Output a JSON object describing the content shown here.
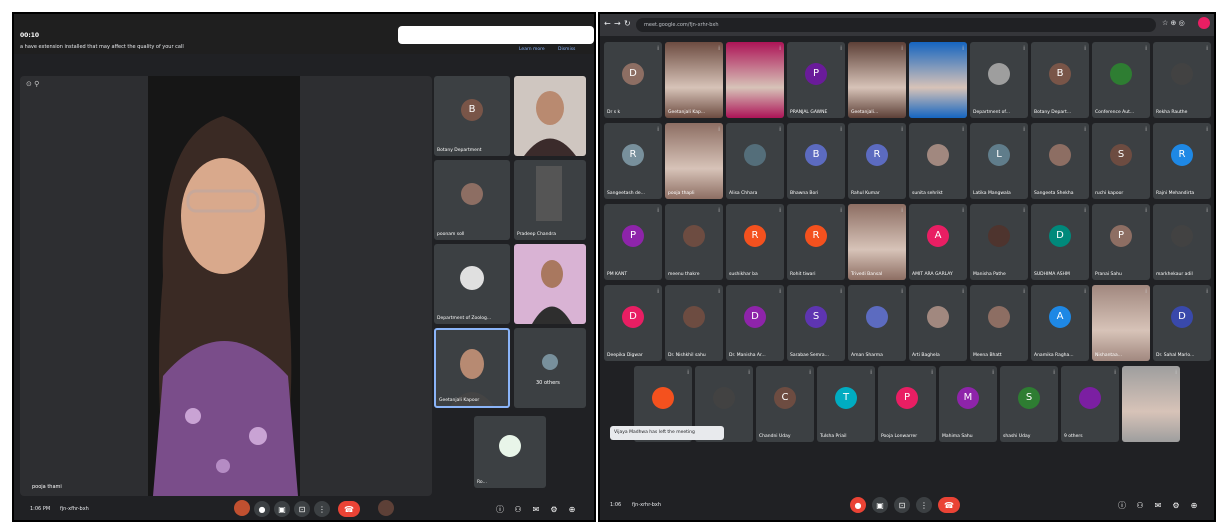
{
  "left": {
    "time_badge": "00:10",
    "warning": "a have extension installed that may affect the quality of your call",
    "warning_links": [
      "Learn more",
      "Dismiss"
    ],
    "main_speaker_name": "pooja thami",
    "sidebar_tiles": [
      {
        "label": "Botany Department",
        "avatar": "B",
        "color": "#795548"
      },
      {
        "label": "",
        "avatar": "",
        "color": "#5f6368"
      },
      {
        "label": "poonam soll",
        "avatar": "",
        "color": "#5f6368"
      },
      {
        "label": "Pradeep Chandra",
        "avatar": "",
        "color": "#5f6368"
      },
      {
        "label": "Department of Zoolog...",
        "avatar": "",
        "color": "#5f6368"
      },
      {
        "label": "",
        "avatar": "",
        "color": "#5f6368"
      },
      {
        "label": "Geetanjali Kapoor",
        "avatar": "",
        "color": "#5f6368"
      },
      {
        "label": "30 others",
        "avatar": "",
        "color": "#5f6368"
      },
      {
        "label": "Ro...",
        "avatar": "",
        "color": "#5f6368"
      }
    ],
    "bottom_time": "1:06 PM",
    "meeting_code": "fjn-xfhr-bxh"
  },
  "right": {
    "url": "meet.google.com/fjn-xrhr-bxh",
    "rows": [
      [
        {
          "label": "Dr s k",
          "avatar": "D",
          "color": "#8d6e63"
        },
        {
          "label": "Geetanjali Kap...",
          "avatar": "",
          "color": "#6d4c41",
          "photo": true
        },
        {
          "label": "",
          "avatar": "",
          "color": "#ad1457",
          "photo": true
        },
        {
          "label": "PRANJAL GAWNE",
          "avatar": "P",
          "color": "#6a1b9a"
        },
        {
          "label": "Geetanjali...",
          "avatar": "",
          "color": "#5d4037",
          "photo": true
        },
        {
          "label": "",
          "avatar": "",
          "color": "#1565c0",
          "photo": true
        },
        {
          "label": "Department of...",
          "avatar": "",
          "color": "#9e9e9e"
        },
        {
          "label": "Botany Depart...",
          "avatar": "B",
          "color": "#795548"
        },
        {
          "label": "Conference Aut...",
          "avatar": "",
          "color": "#2e7d32"
        },
        {
          "label": "Rekha Rauthe",
          "avatar": "",
          "color": "#424242"
        }
      ],
      [
        {
          "label": "Sangeetash de...",
          "avatar": "R",
          "color": "#78909c"
        },
        {
          "label": "pooja thapli",
          "avatar": "",
          "color": "#8d6e63",
          "photo": true
        },
        {
          "label": "Alisa Chhara",
          "avatar": "",
          "color": "#546e7a"
        },
        {
          "label": "Bhawna Bori",
          "avatar": "B",
          "color": "#5c6bc0"
        },
        {
          "label": "Rahul Kumar",
          "avatar": "R",
          "color": "#5c6bc0"
        },
        {
          "label": "sunita sehrikt",
          "avatar": "",
          "color": "#a1887f"
        },
        {
          "label": "Latika Mangwala",
          "avatar": "L",
          "color": "#607d8b"
        },
        {
          "label": "Sangeeta Shekha",
          "avatar": "",
          "color": "#8d6e63"
        },
        {
          "label": "ruchi kapoor",
          "avatar": "S",
          "color": "#6d4c41"
        },
        {
          "label": "Rajni Mehandirta",
          "avatar": "R",
          "color": "#1e88e5"
        }
      ],
      [
        {
          "label": "PM KANT",
          "avatar": "P",
          "color": "#8e24aa"
        },
        {
          "label": "meenu thakre",
          "avatar": "",
          "color": "#6d4c41"
        },
        {
          "label": "sushikhar ba",
          "avatar": "R",
          "color": "#f4511e"
        },
        {
          "label": "Rohit tiwari",
          "avatar": "R",
          "color": "#f4511e"
        },
        {
          "label": "Trivedi Bansal",
          "avatar": "",
          "color": "#8d6e63",
          "photo": true
        },
        {
          "label": "AMIT ARA GARLAY",
          "avatar": "A",
          "color": "#e91e63"
        },
        {
          "label": "Manisha Pathe",
          "avatar": "",
          "color": "#4e342e"
        },
        {
          "label": "SUDHIMA ASHM",
          "avatar": "D",
          "color": "#00897b"
        },
        {
          "label": "Pranai Sahu",
          "avatar": "P",
          "color": "#8d6e63"
        },
        {
          "label": "markhekaur adil",
          "avatar": "",
          "color": "#424242"
        }
      ],
      [
        {
          "label": "Deepika Digwar",
          "avatar": "D",
          "color": "#e91e63"
        },
        {
          "label": "Dr. Nishkhil sahu",
          "avatar": "",
          "color": "#6d4c41"
        },
        {
          "label": "Dr. Manisha Ar...",
          "avatar": "D",
          "color": "#8e24aa"
        },
        {
          "label": "Sarabae Semra...",
          "avatar": "S",
          "color": "#5e35b1"
        },
        {
          "label": "Aman Sharma",
          "avatar": "",
          "color": "#5c6bc0"
        },
        {
          "label": "Arti Baghela",
          "avatar": "",
          "color": "#a1887f"
        },
        {
          "label": "Meena Bhatt",
          "avatar": "",
          "color": "#8d6e63"
        },
        {
          "label": "Anamika Ragha...",
          "avatar": "A",
          "color": "#1e88e5"
        },
        {
          "label": "Nishantaa...",
          "avatar": "",
          "color": "#a1887f",
          "photo": true
        },
        {
          "label": "Dr. Sahal Marlo...",
          "avatar": "D",
          "color": "#3949ab"
        }
      ]
    ],
    "last_row": [
      {
        "label": "",
        "avatar": "",
        "color": "#f4511e"
      },
      {
        "label": "Anshagta",
        "avatar": "",
        "color": "#424242"
      },
      {
        "label": "Chandni Uday",
        "avatar": "C",
        "color": "#6d4c41"
      },
      {
        "label": "Tulsha Priail",
        "avatar": "T",
        "color": "#00acc1"
      },
      {
        "label": "Pooja Lonwarrer",
        "avatar": "P",
        "color": "#e91e63"
      },
      {
        "label": "Mahima Sahu",
        "avatar": "M",
        "color": "#8e24aa"
      },
      {
        "label": "shashi Uday",
        "avatar": "S",
        "color": "#2e7d32"
      },
      {
        "label": "9 others",
        "avatar": "",
        "color": "#7b1fa2"
      },
      {
        "label": "",
        "avatar": "",
        "color": "#9e9e9e",
        "photo": true
      }
    ],
    "toast": "Vijaya Madhwa has left the meeting",
    "bottom_time": "1:06",
    "meeting_code": "fjn-xrhr-bxh"
  }
}
